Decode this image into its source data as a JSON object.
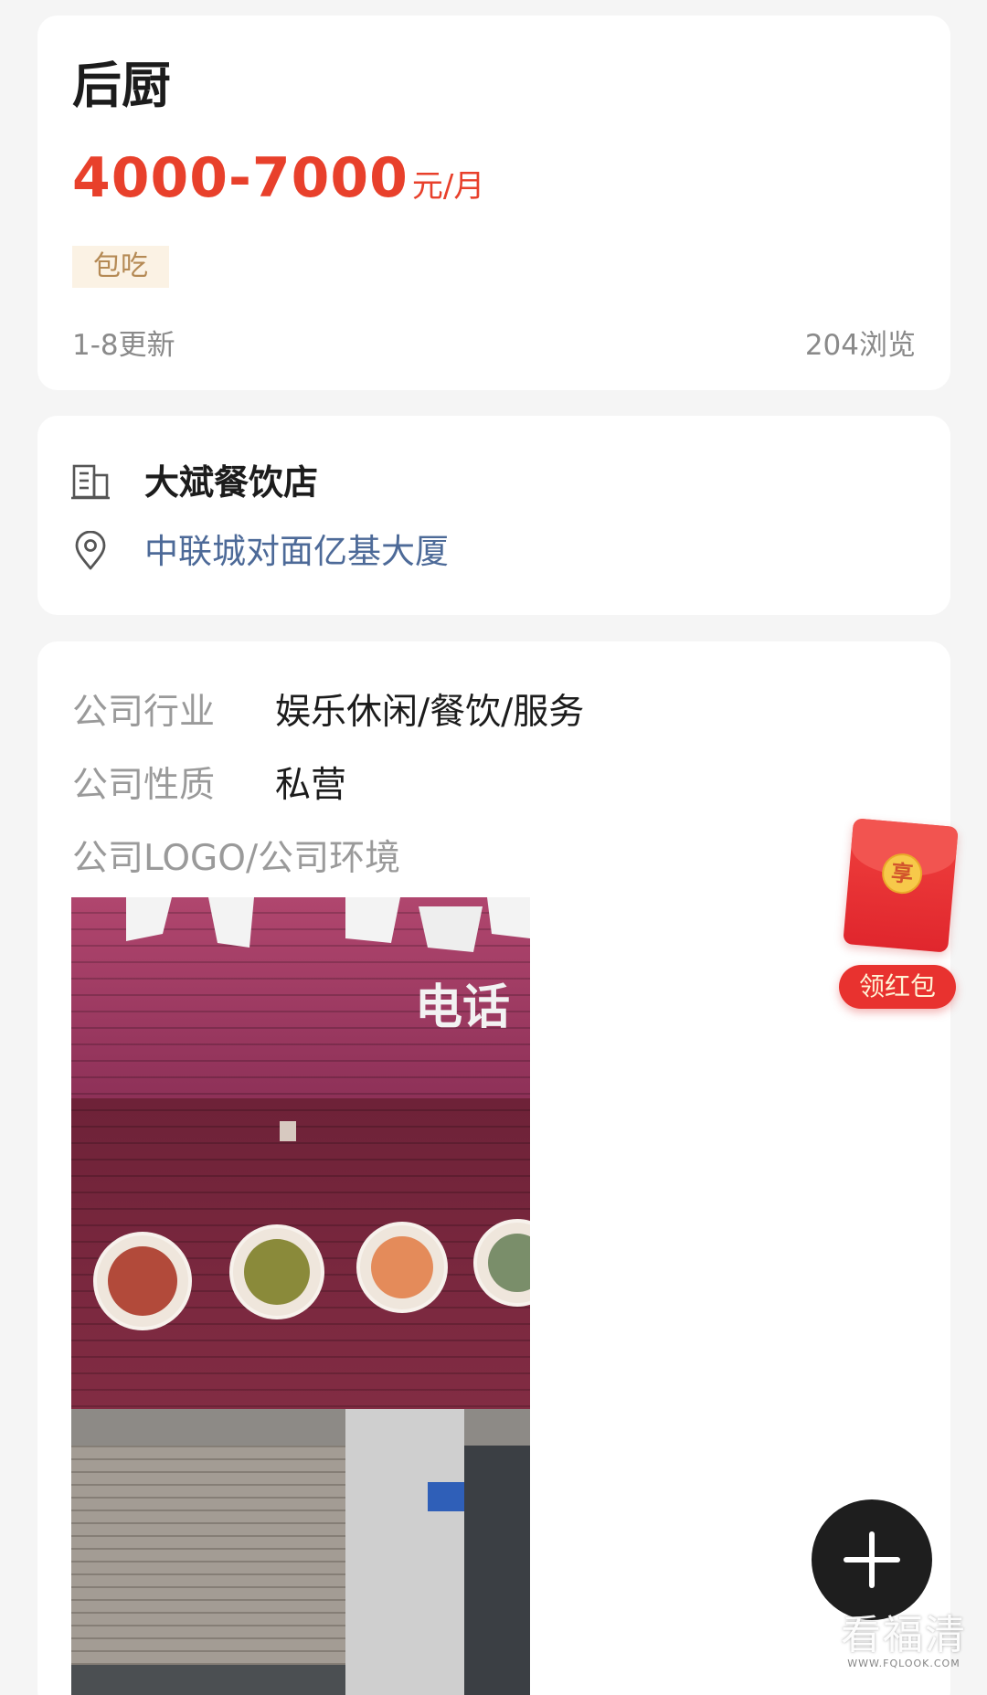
{
  "job": {
    "title": "后厨",
    "salary_range": "4000-7000",
    "salary_unit": "元/月",
    "tags": [
      "包吃"
    ],
    "updated": "1-8更新",
    "views": "204浏览"
  },
  "company": {
    "name": "大斌餐饮店",
    "address": "中联城对面亿基大厦",
    "name_icon": "building-icon",
    "address_icon": "location-pin-icon"
  },
  "info": {
    "industry_label": "公司行业",
    "industry_value": "娱乐休闲/餐饮/服务",
    "nature_label": "公司性质",
    "nature_value": "私营",
    "photos_label": "公司LOGO/公司环境",
    "photo_sign_text": "电话"
  },
  "red_envelope": {
    "coin_text": "享",
    "button_label": "领红包"
  },
  "fab": {
    "icon": "plus-icon"
  },
  "watermark": {
    "main": "看福清",
    "sub": "WWW.FQLOOK.COM"
  },
  "colors": {
    "accent": "#e8402b",
    "address": "#4d6a98",
    "tag_bg": "#fbf2e4",
    "tag_text": "#b58a55"
  }
}
